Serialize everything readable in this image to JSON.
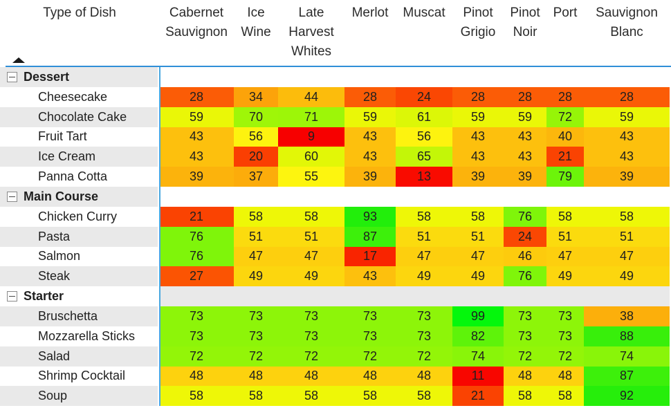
{
  "table": {
    "row_header_label": "Type of Dish",
    "columns": [
      "Cabernet Sauvignon",
      "Ice Wine",
      "Late Harvest Whites",
      "Merlot",
      "Muscat",
      "Pinot Grigio",
      "Pinot Noir",
      "Port",
      "Sauvignon Blanc"
    ],
    "sort_indicator": "ascending-triangle",
    "expander_glyph": "minus-box",
    "accent_color": "#2f8fd8",
    "divider_color": "#4aa8e0",
    "groups": [
      {
        "name": "Dessert",
        "expanded": true,
        "rows": [
          {
            "label": "Cheesecake",
            "values": [
              28,
              34,
              44,
              28,
              24,
              28,
              28,
              28,
              28
            ],
            "colors": [
              "#fb5c06",
              "#fca30a",
              "#fcbc0c",
              "#fb5c06",
              "#fa4703",
              "#fb5c06",
              "#fb5c06",
              "#fb5c06",
              "#fb5c06"
            ]
          },
          {
            "label": "Chocolate Cake",
            "values": [
              59,
              70,
              71,
              59,
              61,
              59,
              59,
              72,
              59
            ],
            "colors": [
              "#eaf707",
              "#9ff608",
              "#9df608",
              "#eaf707",
              "#dcf707",
              "#eaf707",
              "#eaf707",
              "#96f508",
              "#eaf707"
            ]
          },
          {
            "label": "Fruit Tart",
            "values": [
              43,
              56,
              9,
              43,
              56,
              43,
              43,
              40,
              43
            ],
            "colors": [
              "#fdc00d",
              "#fdf30f",
              "#f70000",
              "#fdc00d",
              "#fdf30f",
              "#fdc00d",
              "#fdc00d",
              "#fcb70c",
              "#fdc00d"
            ]
          },
          {
            "label": "Ice Cream",
            "values": [
              43,
              20,
              60,
              43,
              65,
              43,
              43,
              21,
              43
            ],
            "colors": [
              "#fdc00d",
              "#fa3f02",
              "#e2f707",
              "#fdc00d",
              "#c3f608",
              "#fdc00d",
              "#fdc00d",
              "#fa4302",
              "#fdc00d"
            ]
          },
          {
            "label": "Panna Cotta",
            "values": [
              39,
              37,
              55,
              39,
              13,
              39,
              39,
              79,
              39
            ],
            "colors": [
              "#fcb30c",
              "#fcac0b",
              "#fdf50f",
              "#fcb30c",
              "#f90b00",
              "#fcb30c",
              "#fcb30c",
              "#6cf40a",
              "#fcb30c"
            ]
          }
        ]
      },
      {
        "name": "Main Course",
        "expanded": true,
        "rows": [
          {
            "label": "Chicken Curry",
            "values": [
              21,
              58,
              58,
              93,
              58,
              58,
              76,
              58,
              58
            ],
            "colors": [
              "#fa4302",
              "#eef707",
              "#eef707",
              "#22ee0b",
              "#eef707",
              "#eef707",
              "#7ff50a",
              "#eef707",
              "#eef707"
            ]
          },
          {
            "label": "Pasta",
            "values": [
              76,
              51,
              51,
              87,
              51,
              51,
              24,
              51,
              51
            ],
            "colors": [
              "#7ff50a",
              "#fbdb0e",
              "#fbdb0e",
              "#3df00b",
              "#fbdb0e",
              "#fbdb0e",
              "#fa4703",
              "#fbdb0e",
              "#fbdb0e"
            ]
          },
          {
            "label": "Salmon",
            "values": [
              76,
              47,
              47,
              17,
              47,
              47,
              46,
              47,
              47
            ],
            "colors": [
              "#7ff50a",
              "#fdcf0e",
              "#fdcf0e",
              "#f92400",
              "#fdcf0e",
              "#fdcf0e",
              "#fdcb0d",
              "#fdcf0e",
              "#fdcf0e"
            ]
          },
          {
            "label": "Steak",
            "values": [
              27,
              49,
              49,
              43,
              49,
              49,
              76,
              49,
              49
            ],
            "colors": [
              "#fb5403",
              "#fcd60e",
              "#fcd60e",
              "#fdc00d",
              "#fcd60e",
              "#fcd60e",
              "#7ff50a",
              "#fcd60e",
              "#fcd60e"
            ]
          }
        ]
      },
      {
        "name": "Starter",
        "expanded": true,
        "rows": [
          {
            "label": "Bruschetta",
            "values": [
              73,
              73,
              73,
              73,
              73,
              99,
              73,
              73,
              38
            ],
            "colors": [
              "#8df509",
              "#8df509",
              "#8df509",
              "#8df509",
              "#8df509",
              "#04f70c",
              "#8df509",
              "#8df509",
              "#fcaf0b"
            ]
          },
          {
            "label": "Mozzarella Sticks",
            "values": [
              73,
              73,
              73,
              73,
              73,
              82,
              73,
              73,
              88
            ],
            "colors": [
              "#8df509",
              "#8df509",
              "#8df509",
              "#8df509",
              "#8df509",
              "#5ef30a",
              "#8df509",
              "#8df509",
              "#38ef0b"
            ]
          },
          {
            "label": "Salad",
            "values": [
              72,
              72,
              72,
              72,
              72,
              74,
              72,
              72,
              74
            ],
            "colors": [
              "#93f508",
              "#93f508",
              "#93f508",
              "#93f508",
              "#93f508",
              "#89f509",
              "#93f508",
              "#93f508",
              "#89f509"
            ]
          },
          {
            "label": "Shrimp Cocktail",
            "values": [
              48,
              48,
              48,
              48,
              48,
              11,
              48,
              48,
              87
            ],
            "colors": [
              "#fdd20e",
              "#fdd20e",
              "#fdd20e",
              "#fdd20e",
              "#fdd20e",
              "#f80600",
              "#fdd20e",
              "#fdd20e",
              "#3df00b"
            ]
          },
          {
            "label": "Soup",
            "values": [
              58,
              58,
              58,
              58,
              58,
              21,
              58,
              58,
              92
            ],
            "colors": [
              "#eef707",
              "#eef707",
              "#eef707",
              "#eef707",
              "#eef707",
              "#fa4302",
              "#eef707",
              "#eef707",
              "#26ee0b"
            ]
          }
        ]
      }
    ]
  },
  "chart_data": {
    "type": "heatmap",
    "title": "",
    "xlabel": "",
    "ylabel": "Type of Dish",
    "x": [
      "Cabernet Sauvignon",
      "Ice Wine",
      "Late Harvest Whites",
      "Merlot",
      "Muscat",
      "Pinot Grigio",
      "Pinot Noir",
      "Port",
      "Sauvignon Blanc"
    ],
    "y": [
      "Cheesecake",
      "Chocolate Cake",
      "Fruit Tart",
      "Ice Cream",
      "Panna Cotta",
      "Chicken Curry",
      "Pasta",
      "Salmon",
      "Steak",
      "Bruschetta",
      "Mozzarella Sticks",
      "Salad",
      "Shrimp Cocktail",
      "Soup"
    ],
    "y_groups": [
      "Dessert",
      "Dessert",
      "Dessert",
      "Dessert",
      "Dessert",
      "Main Course",
      "Main Course",
      "Main Course",
      "Main Course",
      "Starter",
      "Starter",
      "Starter",
      "Starter",
      "Starter"
    ],
    "values": [
      [
        28,
        34,
        44,
        28,
        24,
        28,
        28,
        28,
        28
      ],
      [
        59,
        70,
        71,
        59,
        61,
        59,
        59,
        72,
        59
      ],
      [
        43,
        56,
        9,
        43,
        56,
        43,
        43,
        40,
        43
      ],
      [
        43,
        20,
        60,
        43,
        65,
        43,
        43,
        21,
        43
      ],
      [
        39,
        37,
        55,
        39,
        13,
        39,
        39,
        79,
        39
      ],
      [
        21,
        58,
        58,
        93,
        58,
        58,
        76,
        58,
        58
      ],
      [
        76,
        51,
        51,
        87,
        51,
        51,
        24,
        51,
        51
      ],
      [
        76,
        47,
        47,
        17,
        47,
        47,
        46,
        47,
        47
      ],
      [
        27,
        49,
        49,
        43,
        49,
        49,
        76,
        49,
        49
      ],
      [
        73,
        73,
        73,
        73,
        73,
        99,
        73,
        73,
        38
      ],
      [
        73,
        73,
        73,
        73,
        73,
        82,
        73,
        73,
        88
      ],
      [
        72,
        72,
        72,
        72,
        72,
        74,
        72,
        72,
        74
      ],
      [
        48,
        48,
        48,
        48,
        48,
        11,
        48,
        48,
        87
      ],
      [
        58,
        58,
        58,
        58,
        58,
        21,
        58,
        58,
        92
      ]
    ],
    "colorscale": "red-yellow-green",
    "vmin": 9,
    "vmax": 99,
    "grid": false,
    "legend": "none"
  }
}
